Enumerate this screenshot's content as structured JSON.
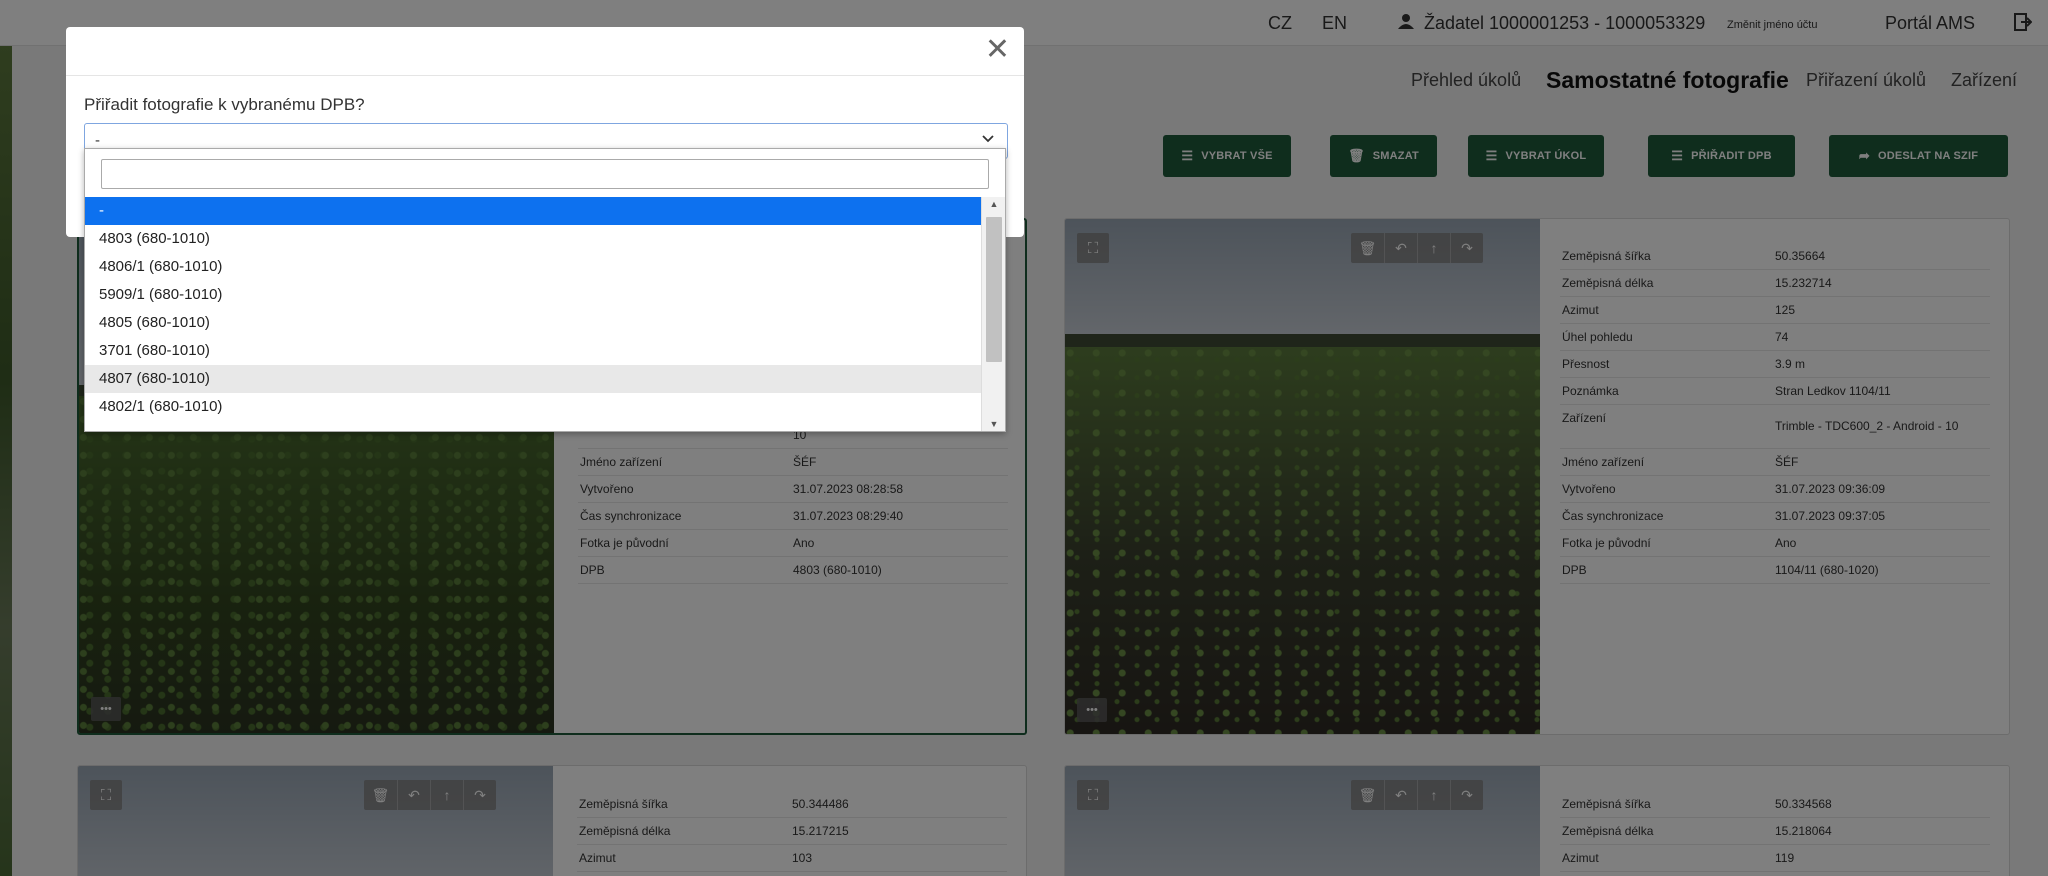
{
  "topbar": {
    "lang_cz": "CZ",
    "lang_en": "EN",
    "user": "Žadatel 1000001253 - 1000053329",
    "change_name": "Změnit jméno účtu",
    "portal": "Portál AMS"
  },
  "nav": {
    "items": [
      "Přehled úkolů",
      "Samostatné fotografie",
      "Přiřazení úkolů",
      "Zařízení"
    ],
    "active": "Samostatné fotografie"
  },
  "toolbar": {
    "select_all": "VYBRAT VŠE",
    "delete": "SMAZAT",
    "select_task": "VYBRAT ÚKOL",
    "assign_dpb": "PŘIŘADIT DPB",
    "send_szif": "ODESLAT NA SZIF"
  },
  "cards": [
    {
      "rows": [
        [
          "",
          "10"
        ],
        [
          "Jméno zařízení",
          "ŠÉF"
        ],
        [
          "Vytvořeno",
          "31.07.2023 08:28:58"
        ],
        [
          "Čas synchronizace",
          "31.07.2023 08:29:40"
        ],
        [
          "Fotka je původní",
          "Ano"
        ],
        [
          "DPB",
          "4803 (680-1010)"
        ]
      ]
    },
    {
      "rows": [
        [
          "Zeměpisná šířka",
          "50.35664"
        ],
        [
          "Zeměpisná délka",
          "15.232714"
        ],
        [
          "Azimut",
          "125"
        ],
        [
          "Úhel pohledu",
          "74"
        ],
        [
          "Přesnost",
          "3.9 m"
        ],
        [
          "Poznámka",
          "Stran Ledkov 1104/11"
        ],
        [
          "Zařízení",
          "Trimble - TDC600_2 - Android - 10"
        ],
        [
          "Jméno zařízení",
          "ŠÉF"
        ],
        [
          "Vytvořeno",
          "31.07.2023 09:36:09"
        ],
        [
          "Čas synchronizace",
          "31.07.2023 09:37:05"
        ],
        [
          "Fotka je původní",
          "Ano"
        ],
        [
          "DPB",
          "1104/11 (680-1020)"
        ]
      ]
    },
    {
      "rows": [
        [
          "Zeměpisná šířka",
          "50.344486"
        ],
        [
          "Zeměpisná délka",
          "15.217215"
        ],
        [
          "Azimut",
          "103"
        ]
      ]
    },
    {
      "rows": [
        [
          "Zeměpisná šířka",
          "50.334568"
        ],
        [
          "Zeměpisná délka",
          "15.218064"
        ],
        [
          "Azimut",
          "119"
        ]
      ]
    }
  ],
  "modal": {
    "question": "Přiřadit fotografie k vybranému DPB?",
    "selected": "-",
    "search_value": "",
    "options": [
      "-",
      "4803 (680-1010)",
      "4806/1 (680-1010)",
      "5909/1 (680-1010)",
      "4805 (680-1010)",
      "3701 (680-1010)",
      "4807 (680-1010)",
      "4802/1 (680-1010)"
    ],
    "highlighted_index": 0,
    "hovered_index": 6
  },
  "icons": {
    "close": "close-icon",
    "chevron": "chevron-down-icon",
    "user": "user-icon",
    "logout": "logout-icon",
    "fullscreen": "fullscreen-icon",
    "trash": "trash-icon",
    "undo": "undo-icon",
    "arrow_up": "arrow-up-icon",
    "redo": "redo-icon"
  },
  "colors": {
    "accent_green": "#1e5b3a",
    "highlight_blue": "#0d71ef"
  }
}
